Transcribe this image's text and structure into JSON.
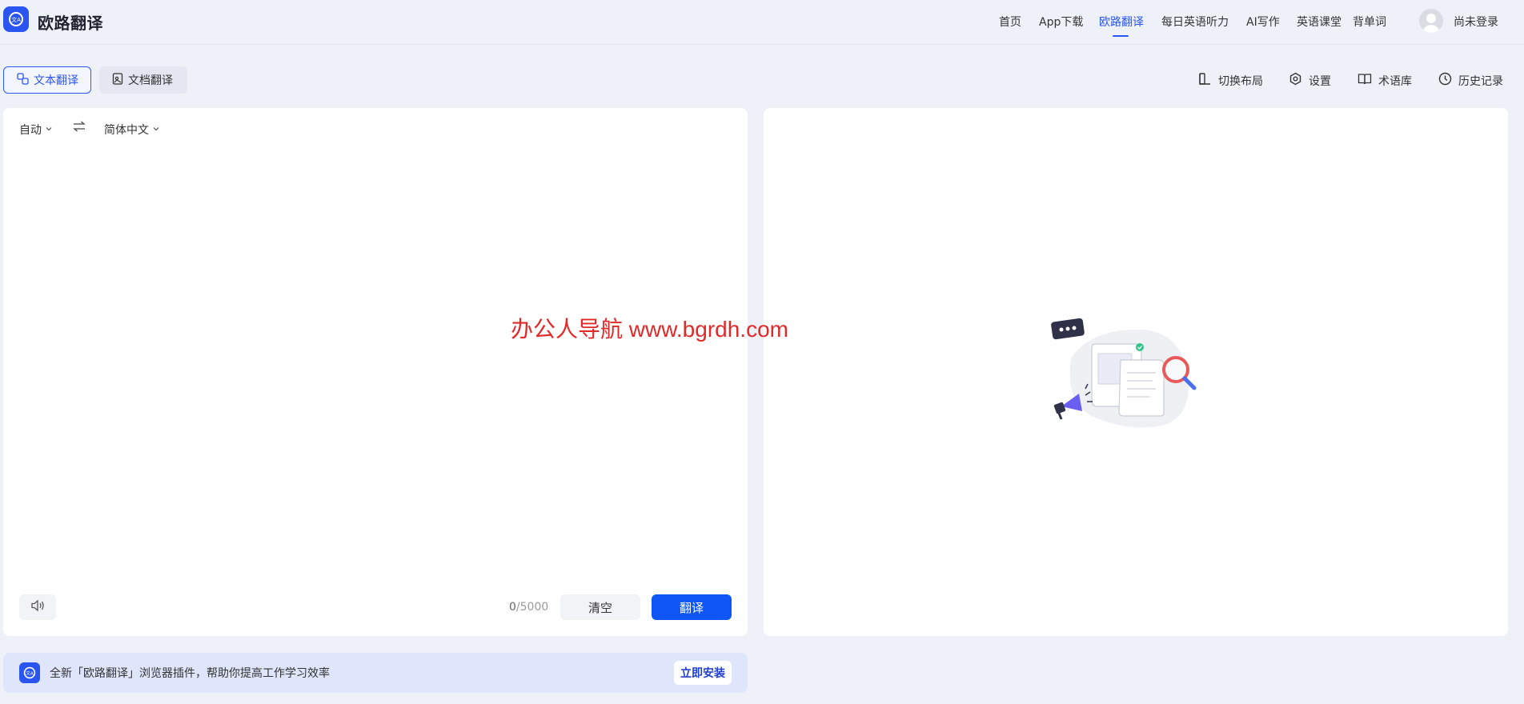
{
  "header": {
    "brand": "欧路翻译",
    "nav": [
      {
        "label": "首页",
        "active": false
      },
      {
        "label": "App下载",
        "active": false
      },
      {
        "label": "欧路翻译",
        "active": true
      },
      {
        "label": "每日英语听力",
        "active": false
      },
      {
        "label": "AI写作",
        "active": false
      },
      {
        "label": "英语课堂",
        "active": false
      },
      {
        "label": "背单词",
        "active": false
      }
    ],
    "login_label": "尚未登录"
  },
  "mode_tabs": {
    "text": "文本翻译",
    "document": "文档翻译"
  },
  "toolbar": {
    "layout": "切换布局",
    "settings": "设置",
    "glossary": "术语库",
    "history": "历史记录"
  },
  "source": {
    "from_lang": "自动",
    "to_lang": "简体中文",
    "count_current": "0",
    "count_max": "/5000",
    "clear_label": "清空",
    "translate_label": "翻译"
  },
  "watermark": "办公人导航 www.bgrdh.com",
  "banner": {
    "text": "全新「欧路翻译」浏览器插件，帮助你提高工作学习效率",
    "install_label": "立即安装"
  },
  "colors": {
    "accent": "#2b55f0",
    "primary_button": "#1055f5",
    "page_bg": "#eff1f9",
    "watermark": "#e02a2a"
  },
  "icons": [
    "logo-icon",
    "text-translate-icon",
    "document-icon",
    "layout-icon",
    "settings-icon",
    "glossary-icon",
    "history-icon",
    "swap-icon",
    "chevron-down-icon",
    "speaker-icon",
    "empty-illustration"
  ]
}
